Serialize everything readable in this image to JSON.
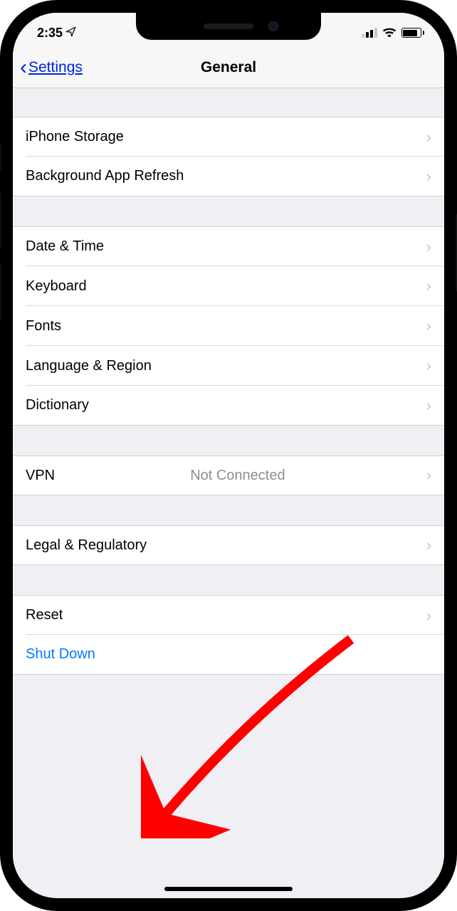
{
  "status": {
    "time": "2:35",
    "location_icon": "➤"
  },
  "nav": {
    "back_label": "Settings",
    "title": "General"
  },
  "rows": {
    "iphone_storage": "iPhone Storage",
    "background_refresh": "Background App Refresh",
    "date_time": "Date & Time",
    "keyboard": "Keyboard",
    "fonts": "Fonts",
    "language_region": "Language & Region",
    "dictionary": "Dictionary",
    "vpn": "VPN",
    "vpn_status": "Not Connected",
    "legal": "Legal & Regulatory",
    "reset": "Reset",
    "shut_down": "Shut Down"
  }
}
